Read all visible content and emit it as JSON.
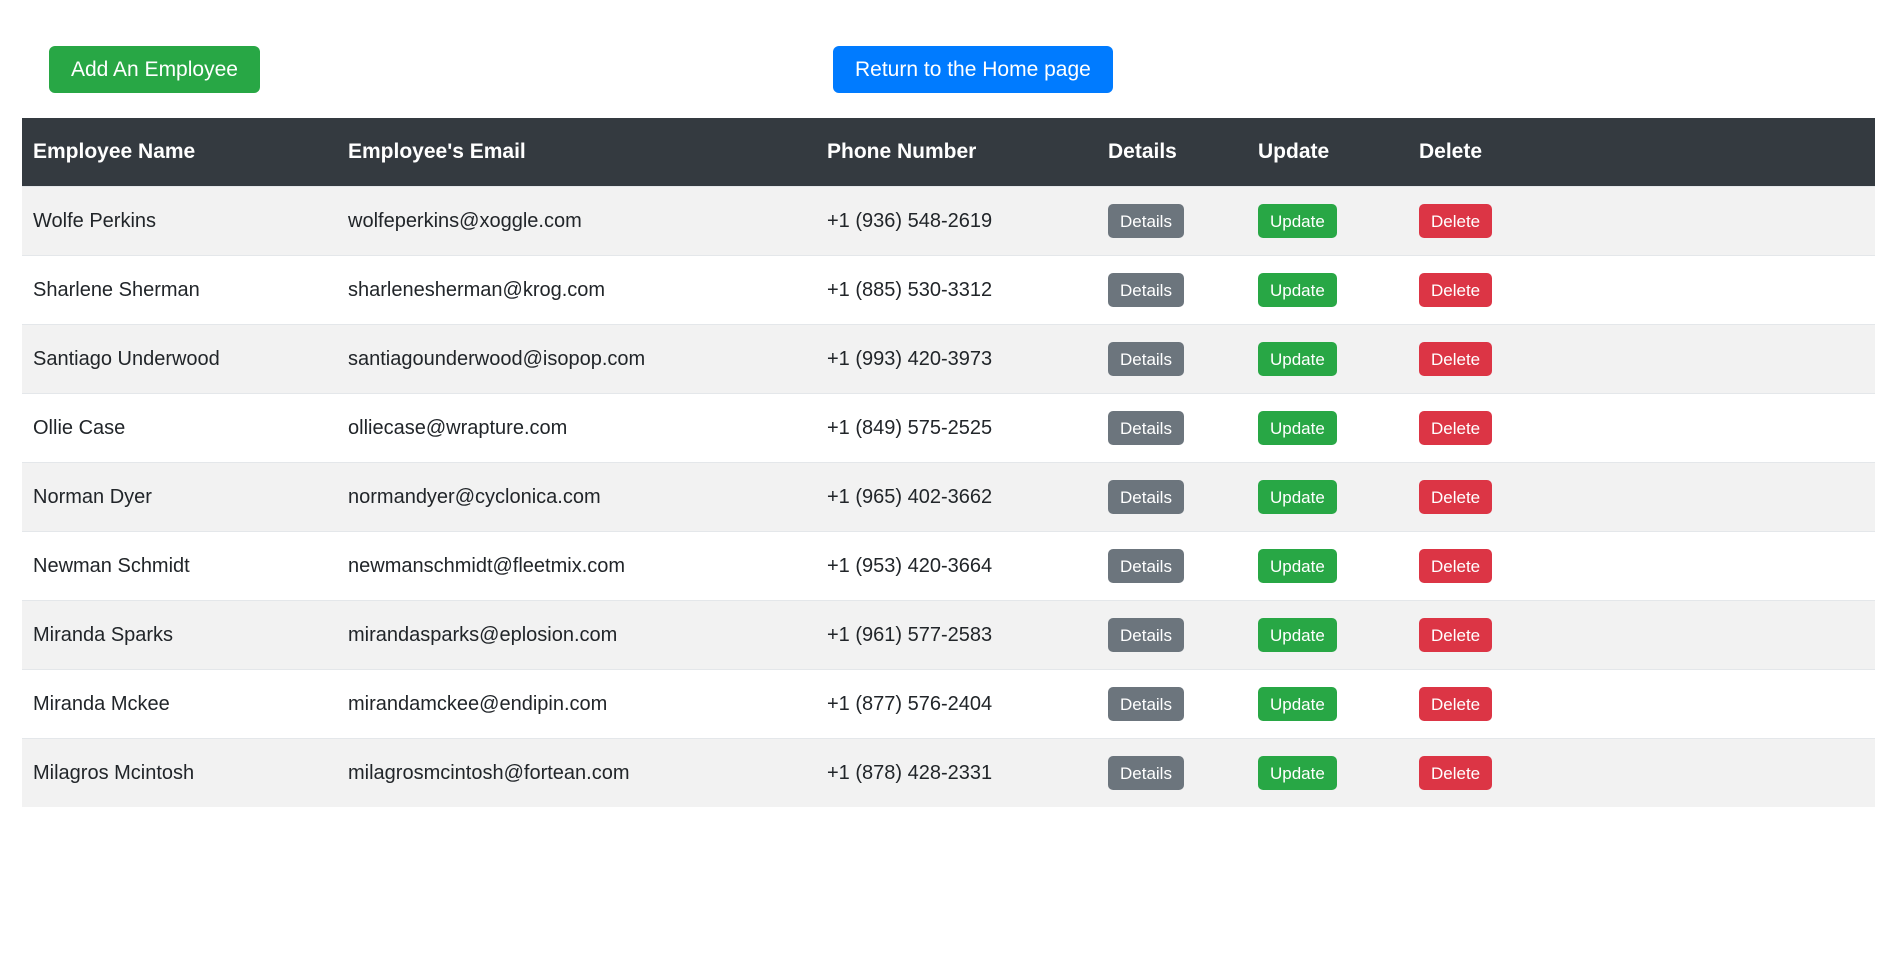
{
  "toolbar": {
    "add_employee_label": "Add An Employee",
    "return_home_label": "Return to the Home page",
    "add_employee_color": "#28a745",
    "return_home_color": "#007bff"
  },
  "table": {
    "header_bg": "#343a40",
    "stripe_bg": "#f2f2f2",
    "columns": [
      "Employee Name",
      "Employee's Email",
      "Phone Number",
      "Details",
      "Update",
      "Delete"
    ],
    "row_actions": {
      "details_label": "Details",
      "update_label": "Update",
      "delete_label": "Delete",
      "details_color": "#6c757d",
      "update_color": "#28a745",
      "delete_color": "#dc3545"
    },
    "rows": [
      {
        "name": "Wolfe Perkins",
        "email": "wolfeperkins@xoggle.com",
        "phone": "+1 (936) 548-2619"
      },
      {
        "name": "Sharlene Sherman",
        "email": "sharlenesherman@krog.com",
        "phone": "+1 (885) 530-3312"
      },
      {
        "name": "Santiago Underwood",
        "email": "santiagounderwood@isopop.com",
        "phone": "+1 (993) 420-3973"
      },
      {
        "name": "Ollie Case",
        "email": "olliecase@wrapture.com",
        "phone": "+1 (849) 575-2525"
      },
      {
        "name": "Norman Dyer",
        "email": "normandyer@cyclonica.com",
        "phone": "+1 (965) 402-3662"
      },
      {
        "name": "Newman Schmidt",
        "email": "newmanschmidt@fleetmix.com",
        "phone": "+1 (953) 420-3664"
      },
      {
        "name": "Miranda Sparks",
        "email": "mirandasparks@eplosion.com",
        "phone": "+1 (961) 577-2583"
      },
      {
        "name": "Miranda Mckee",
        "email": "mirandamckee@endipin.com",
        "phone": "+1 (877) 576-2404"
      },
      {
        "name": "Milagros Mcintosh",
        "email": "milagrosmcintosh@fortean.com",
        "phone": "+1 (878) 428-2331"
      }
    ]
  }
}
